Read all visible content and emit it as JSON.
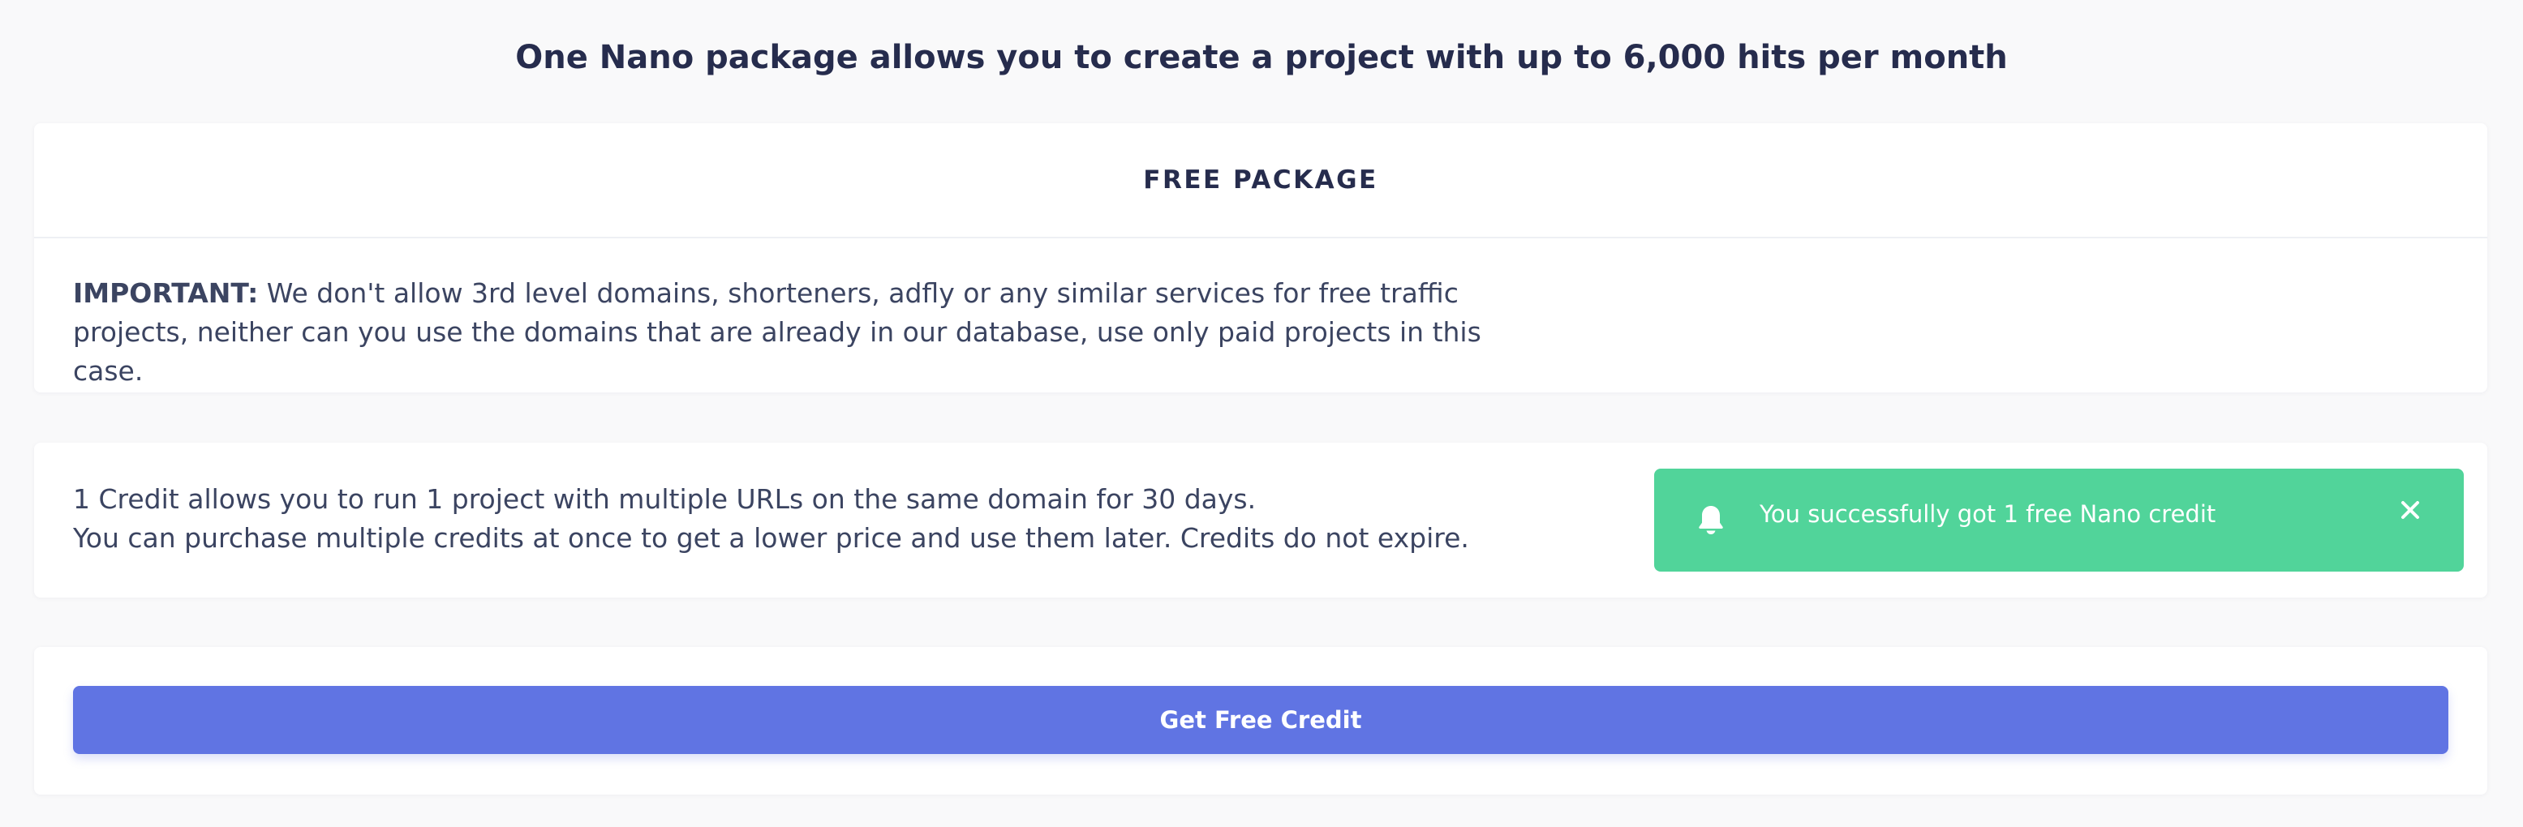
{
  "header": {
    "title": "One Nano package allows you to create a project with up to 6,000 hits per month"
  },
  "package_card": {
    "title": "FREE PACKAGE",
    "important_label": "IMPORTANT:",
    "important_text": " We don't allow 3rd level domains, shorteners, adfly or any similar services for free traffic projects, neither can you use the domains that are already in our database, use only paid projects in this case."
  },
  "info_card": {
    "line1": "1 Credit allows you to run 1 project with multiple URLs on the same domain for 30 days.",
    "line2": "You can purchase multiple credits at once to get a lower price and use them later. Credits do not expire."
  },
  "notification": {
    "message": "You successfully got 1 free Nano credit",
    "icon": "bell-icon",
    "close_icon": "close-icon",
    "color": "#51d49a"
  },
  "action": {
    "button_label": "Get Free Credit",
    "color": "#6074e3"
  }
}
